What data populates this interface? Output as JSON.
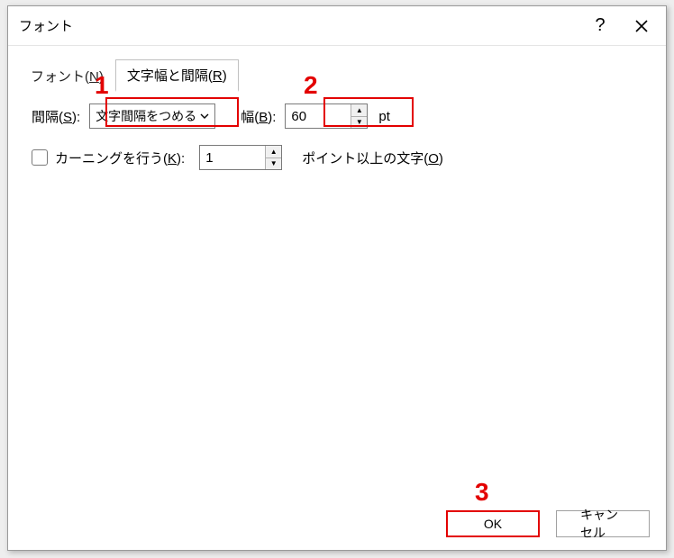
{
  "window": {
    "title": "フォント"
  },
  "titlebar": {
    "help": "?",
    "close": "×"
  },
  "tabs": {
    "font": {
      "label_pre": "フォント(",
      "key": "N",
      "label_post": ")"
    },
    "spacing": {
      "label_pre": "文字幅と間隔(",
      "key": "R",
      "label_post": ")"
    }
  },
  "row1": {
    "spacing_label_pre": "間隔(",
    "spacing_key": "S",
    "spacing_label_post": "):",
    "spacing_value": "文字間隔をつめる",
    "width_label_pre": "幅(",
    "width_key": "B",
    "width_label_post": "):",
    "width_value": "60",
    "width_unit": "pt"
  },
  "row2": {
    "kerning_label_pre": "カーニングを行う(",
    "kerning_key": "K",
    "kerning_label_post": "):",
    "kerning_value": "1",
    "kerning_after_pre": "ポイント以上の文字(",
    "kerning_after_key": "O",
    "kerning_after_post": ")"
  },
  "footer": {
    "ok": "OK",
    "cancel": "キャンセル"
  },
  "annotations": {
    "n1": "1",
    "n2": "2",
    "n3": "3"
  }
}
